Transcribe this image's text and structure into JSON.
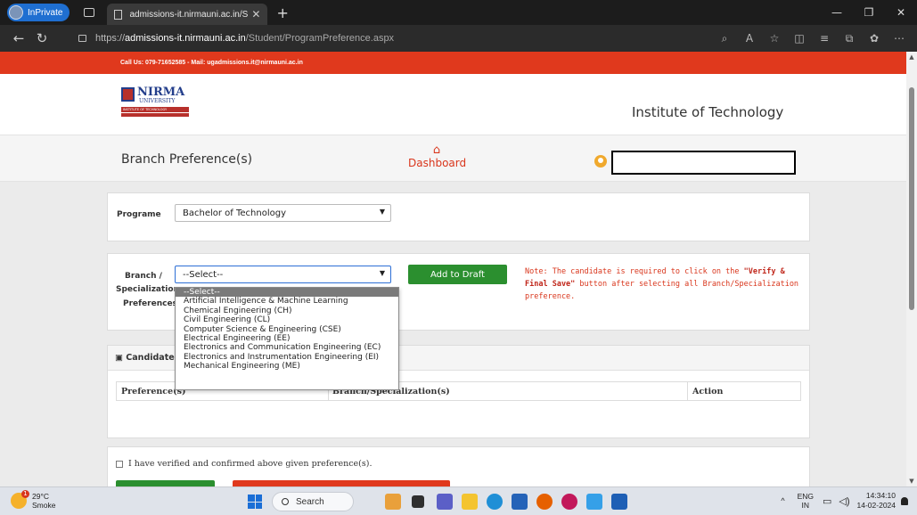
{
  "browser": {
    "inprivate_label": "InPrivate",
    "tab_title": "admissions-it.nirmauni.ac.in/Stuc",
    "url_scheme": "https://",
    "url_host": "admissions-it.nirmauni.ac.in",
    "url_path": "/Student/ProgramPreference.aspx"
  },
  "site": {
    "contact": "Call Us: 079-71652585 - Mail: ugadmissions.it@nirmauni.ac.in",
    "logo_name": "NIRMA",
    "logo_university": "UNIVERSITY",
    "logo_strip": "INSTITUTE OF TECHNOLOGY",
    "institute": "Institute of Technology",
    "page_title": "Branch Preference(s)",
    "dashboard_label": "Dashboard"
  },
  "form": {
    "programe_label": "Programe",
    "programe_value": "Bachelor of Technology",
    "branch_label_1": "Branch /",
    "branch_label_2": "Specialization",
    "branch_label_3": "Preferences",
    "branch_value": "--Select--",
    "add_draft": "Add to Draft",
    "note_prefix": "Note: The candidate is required to click on the ",
    "note_bold": "\"Verify & Final Save\"",
    "note_suffix": " button after selecting all Branch/Specialization preference.",
    "options": [
      "--Select--",
      "Artificial Intelligence & Machine Learning",
      "Chemical Engineering (CH)",
      "Civil Engineering (CL)",
      "Computer Science & Engineering (CSE)",
      "Electrical Engineering (EE)",
      "Electronics and Communication Engineering (EC)",
      "Electronics and Instrumentation Engineering (EI)",
      "Mechanical Engineering (ME)"
    ]
  },
  "draft": {
    "heading": "Candidate I",
    "col_pref": "Preference(s)",
    "col_branch": "Branch/Specialization(s)",
    "col_action": "Action"
  },
  "verify_text": "I have verified and confirmed above given preference(s).",
  "taskbar": {
    "temp": "29°C",
    "weather": "Smoke",
    "search": "Search",
    "lang1": "ENG",
    "lang2": "IN",
    "time": "14:34:10",
    "date": "14-02-2024"
  }
}
